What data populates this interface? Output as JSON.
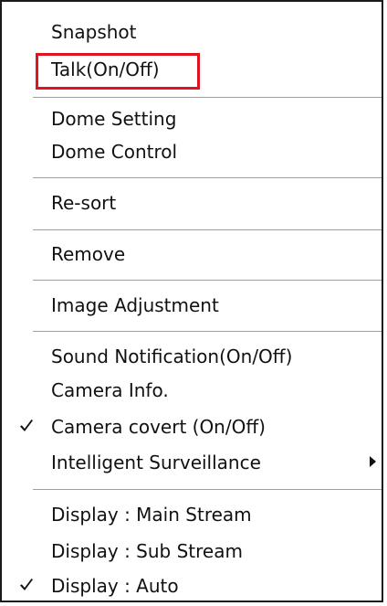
{
  "menu": {
    "items": [
      {
        "label": "Snapshot"
      },
      {
        "label": "Talk(On/Off)"
      },
      {
        "label": "Dome Setting"
      },
      {
        "label": "Dome Control"
      },
      {
        "label": "Re-sort"
      },
      {
        "label": "Remove"
      },
      {
        "label": "Image Adjustment"
      },
      {
        "label": "Sound Notification(On/Off)"
      },
      {
        "label": "Camera Info."
      },
      {
        "label": "Camera covert (On/Off)",
        "checked": true
      },
      {
        "label": "Intelligent Surveillance",
        "has_submenu": true
      },
      {
        "label": "Display : Main Stream"
      },
      {
        "label": "Display : Sub Stream"
      },
      {
        "label": "Display : Auto",
        "checked": true
      }
    ]
  },
  "highlight": {
    "target": "Talk(On/Off)",
    "color": "#e0141e"
  }
}
